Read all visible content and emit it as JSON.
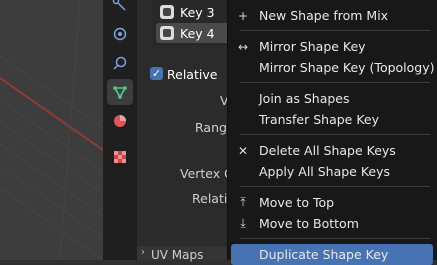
{
  "shape_keys": {
    "items": [
      {
        "label": "Key 3",
        "selected": false
      },
      {
        "label": "Key 4",
        "selected": true
      }
    ]
  },
  "properties": {
    "relative_label": "Relative",
    "value_label": "V",
    "range_label": "Range",
    "vertex_group_label": "Vertex G",
    "relative_to_label": "Relativ",
    "uv_maps_label": "UV Maps"
  },
  "context_menu": {
    "groups": [
      [
        {
          "icon": "plus-icon",
          "glyph": "+",
          "label": "New Shape from Mix"
        }
      ],
      [
        {
          "icon": "mirror-icon",
          "glyph": "↔",
          "label": "Mirror Shape Key"
        },
        {
          "icon": "",
          "glyph": "",
          "label": "Mirror Shape Key (Topology)"
        }
      ],
      [
        {
          "icon": "",
          "glyph": "",
          "label": "Join as Shapes"
        },
        {
          "icon": "",
          "glyph": "",
          "label": "Transfer Shape Key"
        }
      ],
      [
        {
          "icon": "x-icon",
          "glyph": "✕",
          "label": "Delete All Shape Keys"
        },
        {
          "icon": "",
          "glyph": "",
          "label": "Apply All Shape Keys"
        }
      ],
      [
        {
          "icon": "move-to-top-icon",
          "glyph": "⤒",
          "label": "Move to Top"
        },
        {
          "icon": "move-to-bottom-icon",
          "glyph": "⤓",
          "label": "Move to Bottom"
        }
      ],
      [
        {
          "icon": "",
          "glyph": "",
          "label": "Duplicate Shape Key",
          "highlight": true
        }
      ]
    ]
  },
  "colors": {
    "accent": "#4772b3",
    "menu_bg": "#181818",
    "panel_bg": "#2b2b2b",
    "viewport_bg": "#3d3d3d",
    "grid_red": "#8f3a3a"
  }
}
